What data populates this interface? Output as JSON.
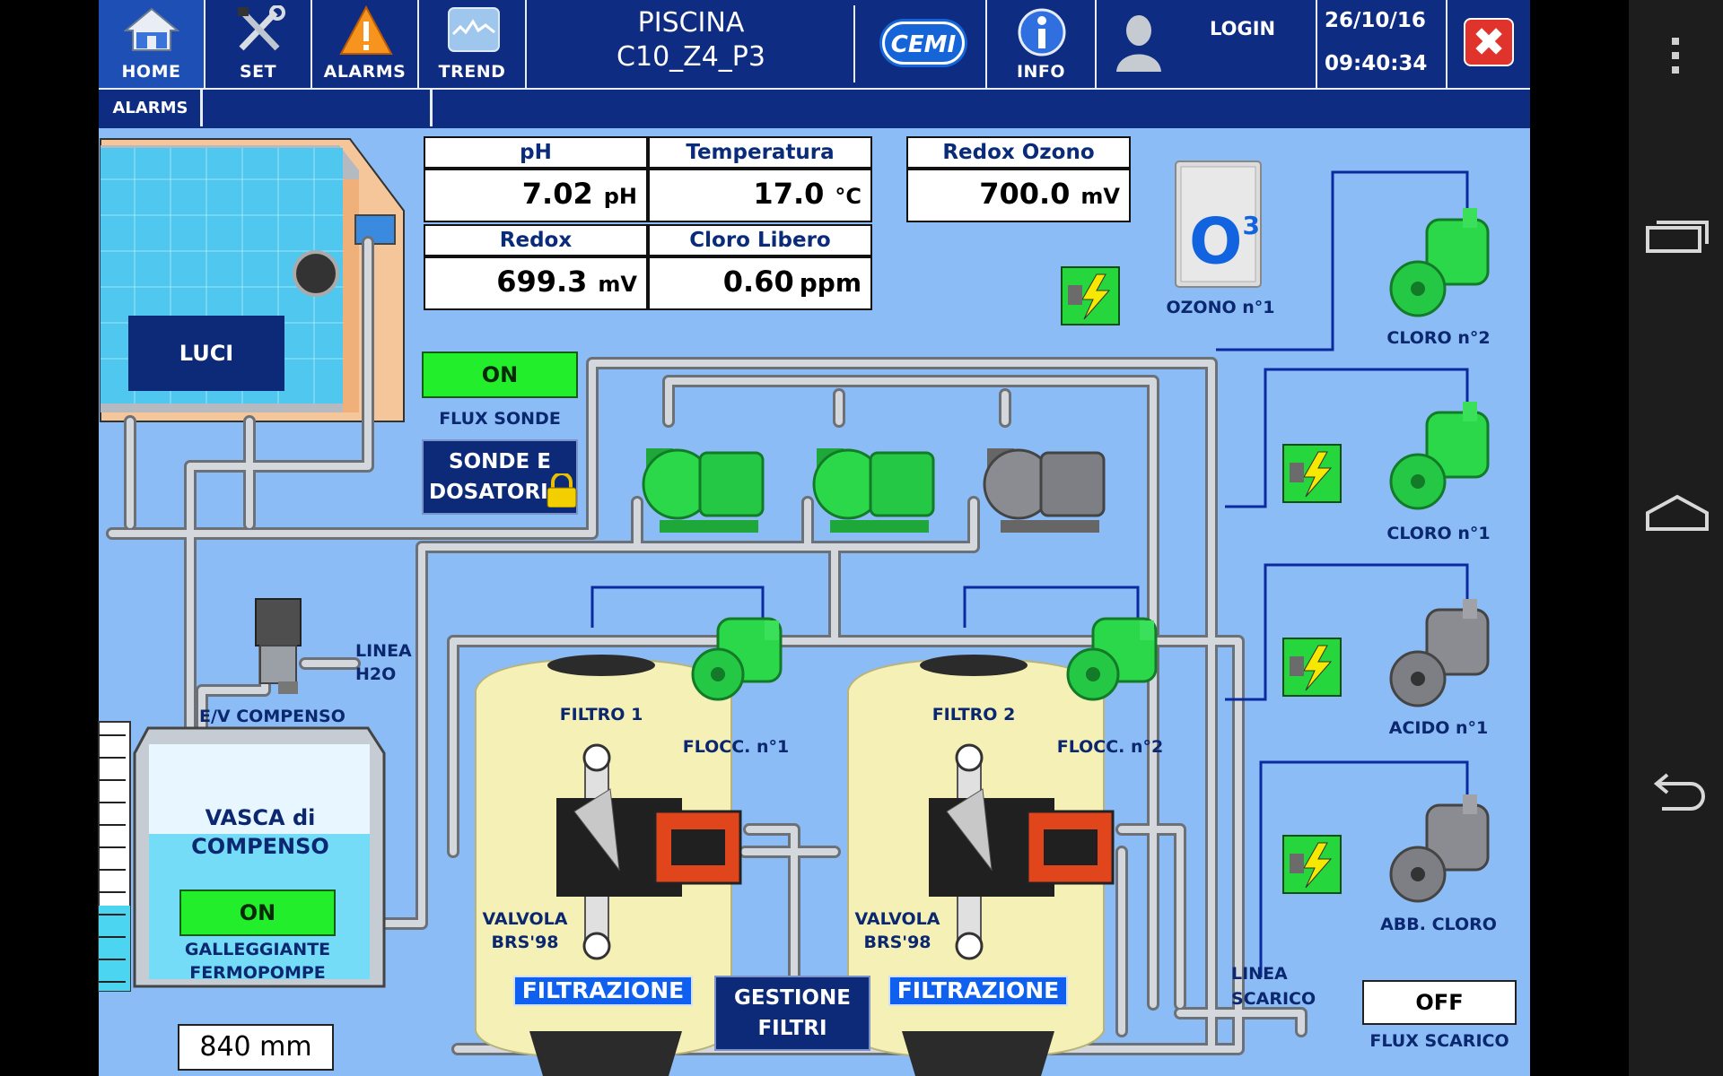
{
  "header": {
    "nav": [
      {
        "label": "HOME",
        "icon": "home-icon"
      },
      {
        "label": "SET",
        "icon": "wrench-icon"
      },
      {
        "label": "ALARMS",
        "icon": "warning-icon"
      },
      {
        "label": "TREND",
        "icon": "trend-icon"
      }
    ],
    "title_line1": "PISCINA",
    "title_line2": "C10_Z4_P3",
    "brand": "CEMI",
    "info_label": "INFO",
    "login_label": "LOGIN",
    "date": "26/10/16",
    "time": "09:40:34"
  },
  "alarm_bar": {
    "label": "ALARMS"
  },
  "readouts": {
    "ph": {
      "label": "pH",
      "value": "7.02",
      "unit": "pH"
    },
    "temperatura": {
      "label": "Temperatura",
      "value": "17.0",
      "unit": "°C"
    },
    "redox_ozono": {
      "label": "Redox Ozono",
      "value": "700.0",
      "unit": "mV"
    },
    "redox": {
      "label": "Redox",
      "value": "699.3",
      "unit": "mV"
    },
    "cloro_libero": {
      "label": "Cloro Libero",
      "value": "0.60",
      "unit": "ppm"
    }
  },
  "pool": {
    "luci_label": "LUCI"
  },
  "flux_sonde": {
    "status": "ON",
    "label": "FLUX SONDE"
  },
  "sonde_dosatori": {
    "label_line1": "SONDE E",
    "label_line2": "DOSATORI"
  },
  "ozono": {
    "label": "OZONO n°1",
    "glyph": "O",
    "sup": "3"
  },
  "dosing": {
    "cloro2": "CLORO n°2",
    "cloro1": "CLORO n°1",
    "acido1": "ACIDO n°1",
    "abb_cloro": "ABB. CLORO"
  },
  "linea_h2o": {
    "line1": "LINEA",
    "line2": "H2O"
  },
  "ev_compenso": "E/V COMPENSO",
  "vasca": {
    "line1": "VASCA di",
    "line2": "COMPENSO",
    "status": "ON",
    "galleggiante_line1": "GALLEGGIANTE",
    "galleggiante_line2": "FERMOPOMPE",
    "level": "840 mm",
    "level_fraction": 0.62
  },
  "filtro1": {
    "label": "FILTRO 1",
    "flocc": "FLOCC. n°1",
    "valvola_line1": "VALVOLA",
    "valvola_line2": "BRS'98",
    "filtr": "FILTRAZIONE"
  },
  "filtro2": {
    "label": "FILTRO 2",
    "flocc": "FLOCC. n°2",
    "valvola_line1": "VALVOLA",
    "valvola_line2": "BRS'98",
    "filtr": "FILTRAZIONE"
  },
  "gestione_filtri": {
    "line1": "GESTIONE",
    "line2": "FILTRI"
  },
  "linea_scarico": {
    "line1": "LINEA",
    "line2": "SCARICO"
  },
  "flux_scarico": {
    "status": "OFF",
    "label": "FLUX SCARICO"
  },
  "colors": {
    "background": "#8bbcf5",
    "header": "#0d2c82",
    "on_green": "#23ee2c",
    "pump_green": "#2bd84a",
    "pump_grey": "#7d7f85",
    "pipe": "#c8ccd2"
  }
}
